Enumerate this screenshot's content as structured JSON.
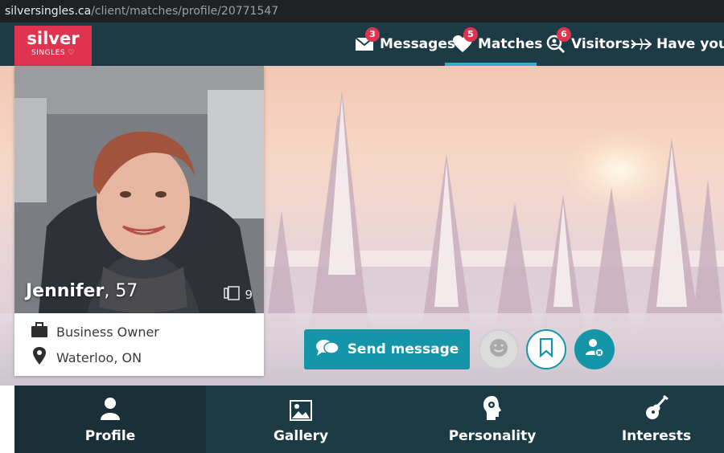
{
  "browser": {
    "url_domain": "silversingles.ca",
    "url_path": "/client/matches/profile/20771547"
  },
  "logo": {
    "main": "silver",
    "sub": "SINGLES"
  },
  "nav": {
    "items": [
      {
        "label": "Messages",
        "badge": "3",
        "icon": "envelope-icon"
      },
      {
        "label": "Matches",
        "badge": "5",
        "icon": "heart-icon",
        "active": true
      },
      {
        "label": "Visitors",
        "badge": "6",
        "icon": "magnifier-person-icon"
      },
      {
        "label": "Have you m",
        "icon": "cupid-arrow-icon"
      }
    ]
  },
  "profile": {
    "name": "Jennifer",
    "age": ", 57",
    "photo_count": "9",
    "occupation": "Business Owner",
    "location": "Waterloo, ON"
  },
  "actions": {
    "send_message": "Send message",
    "smile_icon": "smile-icon",
    "bookmark_icon": "bookmark-icon",
    "block_icon": "person-block-icon"
  },
  "tabs": [
    {
      "label": "Profile",
      "icon": "person-icon",
      "active": true
    },
    {
      "label": "Gallery",
      "icon": "image-icon"
    },
    {
      "label": "Personality",
      "icon": "head-gear-icon"
    },
    {
      "label": "Interests",
      "icon": "guitar-icon"
    }
  ],
  "colors": {
    "brand_red": "#e0334f",
    "nav_bg": "#1d3b45",
    "accent_teal": "#1596a8",
    "active_underline": "#2bb3c7"
  }
}
